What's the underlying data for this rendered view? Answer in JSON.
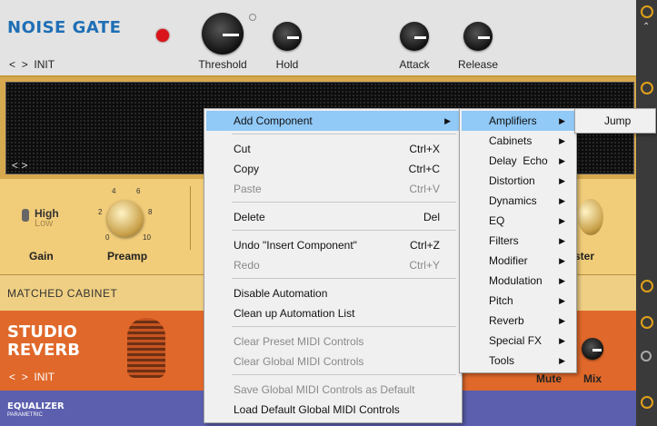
{
  "noise_gate": {
    "title": "NOISE GATE",
    "preset": "INIT",
    "knobs": [
      "Threshold",
      "Hold",
      "Attack",
      "Release"
    ]
  },
  "amp": {
    "switch_high": "High",
    "switch_low": "Low",
    "gain_label": "Gain",
    "preamp_label": "Preamp",
    "preamp_scale": [
      "0",
      "2",
      "4",
      "6",
      "8",
      "10"
    ],
    "master_partial": "ster"
  },
  "cabinet": {
    "label": "MATCHED CABINET"
  },
  "reverb": {
    "title_line1": "STUDIO",
    "title_line2": "REVERB",
    "preset": "INIT",
    "mute_label": "Mute",
    "mix_label": "Mix"
  },
  "equalizer": {
    "title": "EQUALIZER",
    "subtitle": "PARAMETRIC"
  },
  "context_menu": {
    "items": [
      {
        "label": "Add Component",
        "shortcut": "",
        "submenu": true,
        "highlighted": true
      },
      {
        "label": "Cut",
        "shortcut": "Ctrl+X"
      },
      {
        "label": "Copy",
        "shortcut": "Ctrl+C"
      },
      {
        "label": "Paste",
        "shortcut": "Ctrl+V",
        "disabled": true
      },
      {
        "label": "Delete",
        "shortcut": "Del"
      },
      {
        "label": "Undo \"Insert Component\"",
        "shortcut": "Ctrl+Z"
      },
      {
        "label": "Redo",
        "shortcut": "Ctrl+Y",
        "disabled": true
      },
      {
        "label": "Disable Automation",
        "shortcut": ""
      },
      {
        "label": "Clean up Automation List",
        "shortcut": ""
      },
      {
        "label": "Clear Preset MIDI Controls",
        "shortcut": "",
        "disabled": true
      },
      {
        "label": "Clear Global MIDI Controls",
        "shortcut": "",
        "disabled": true
      },
      {
        "label": "Save Global MIDI Controls as Default",
        "shortcut": "",
        "disabled": true
      },
      {
        "label": "Load Default Global MIDI Controls",
        "shortcut": ""
      }
    ]
  },
  "component_submenu": {
    "items": [
      "Amplifiers",
      "Cabinets",
      "Delay  Echo",
      "Distortion",
      "Dynamics",
      "EQ",
      "Filters",
      "Modifier",
      "Modulation",
      "Pitch",
      "Reverb",
      "Special FX",
      "Tools"
    ]
  },
  "amplifiers_submenu": {
    "items": [
      "Jump"
    ]
  },
  "colors": {
    "menu_highlight": "#91c9f7",
    "power_icon": "#e0a11a",
    "noise_gate_title": "#1f6fb5"
  }
}
